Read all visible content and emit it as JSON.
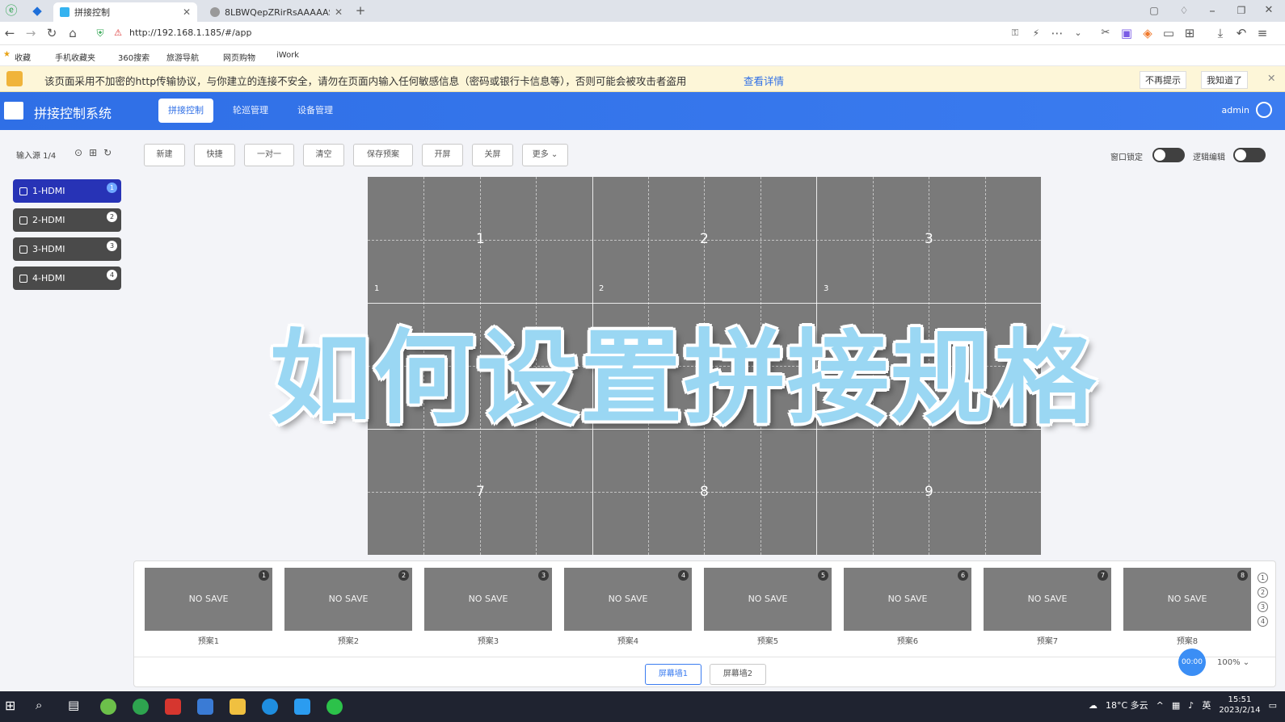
{
  "browser": {
    "tabs": [
      {
        "title": "拼接控制",
        "active": true
      },
      {
        "title": "8LBWQepZRirRsAAAAAS",
        "active": false
      }
    ],
    "url": "http://192.168.1.185/#/app",
    "bookmarks": [
      "收藏",
      "手机收藏夹",
      "360搜索",
      "旅游导航",
      "网页购物",
      "iWork"
    ],
    "warning": {
      "text": "该页面采用不加密的http传输协议，与你建立的连接不安全，请勿在页面内输入任何敏感信息（密码或银行卡信息等），否则可能会被攻击者盗用",
      "link": "查看详情",
      "btn1": "不再提示",
      "btn2": "我知道了"
    }
  },
  "app": {
    "title": "拼接控制系统",
    "nav": [
      "拼接控制",
      "轮巡管理",
      "设备管理"
    ],
    "user": "admin"
  },
  "sources": {
    "header": "输入源 1/4",
    "items": [
      {
        "label": "1-HDMI",
        "num": "1"
      },
      {
        "label": "2-HDMI",
        "num": "2"
      },
      {
        "label": "3-HDMI",
        "num": "3"
      },
      {
        "label": "4-HDMI",
        "num": "4"
      }
    ]
  },
  "toolbar": {
    "buttons": [
      "新建",
      "快捷",
      "一对一",
      "清空",
      "保存预案",
      "开屏",
      "关屏",
      "更多"
    ],
    "lock_label": "窗口锁定",
    "edit_label": "逻辑编辑"
  },
  "wall": {
    "big_numbers": [
      "1",
      "2",
      "3",
      "7",
      "8",
      "9"
    ],
    "small_numbers": [
      "1",
      "2",
      "3"
    ]
  },
  "overlay_title": "如何设置拼接规格",
  "presets": {
    "items": [
      {
        "num": "1",
        "label": "NO SAVE",
        "name": "预案1"
      },
      {
        "num": "2",
        "label": "NO SAVE",
        "name": "预案2"
      },
      {
        "num": "3",
        "label": "NO SAVE",
        "name": "预案3"
      },
      {
        "num": "4",
        "label": "NO SAVE",
        "name": "预案4"
      },
      {
        "num": "5",
        "label": "NO SAVE",
        "name": "预案5"
      },
      {
        "num": "6",
        "label": "NO SAVE",
        "name": "预案6"
      },
      {
        "num": "7",
        "label": "NO SAVE",
        "name": "预案7"
      },
      {
        "num": "8",
        "label": "NO SAVE",
        "name": "预案8"
      }
    ],
    "walls": [
      "屏幕墙1",
      "屏幕墙2"
    ],
    "pages": [
      "1",
      "2",
      "3",
      "4"
    ],
    "timer": "00:00",
    "zoom": "100%"
  },
  "taskbar": {
    "weather": "18°C 多云",
    "ime": "英",
    "time": "15:51",
    "date": "2023/2/14"
  }
}
